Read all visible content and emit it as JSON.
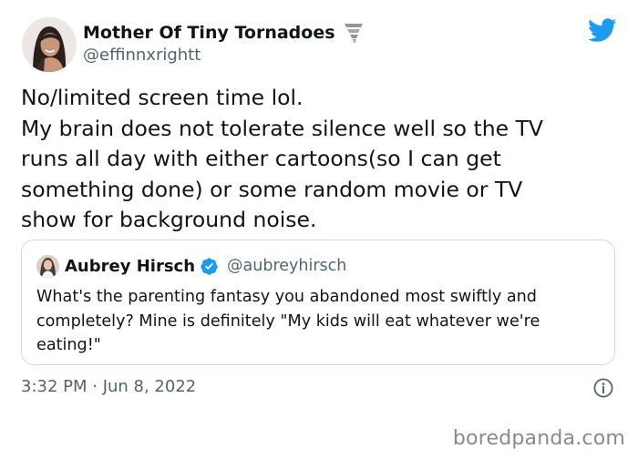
{
  "tweet": {
    "author": {
      "display_name": "Mother Of Tiny Tornadoes",
      "handle": "@effinnxrightt",
      "emoji_icon": "tornado-icon",
      "avatar": "avatar"
    },
    "text_lines": [
      "No/limited screen time lol.",
      "My brain does not tolerate silence well so the TV",
      "runs all day with either cartoons(so I can get",
      "something done) or some random movie or TV",
      "show for background noise."
    ],
    "quote": {
      "display_name": "Aubrey Hirsch",
      "handle": "@aubreyhirsch",
      "verified": true,
      "text_lines": [
        "What's the parenting fantasy you abandoned most swiftly and",
        "completely? Mine is definitely \"My kids will eat whatever we're",
        "eating!\""
      ]
    },
    "timestamp": "3:32 PM · Jun 8, 2022"
  },
  "watermark": "boredpanda.com",
  "colors": {
    "twitter_blue": "#1d9bf0",
    "text_primary": "#0f1419",
    "text_secondary": "#536471",
    "border": "#cfd9de",
    "watermark": "#8a8a8a"
  },
  "icons": {
    "brand": "twitter-bird-icon",
    "verified": "verified-badge-icon",
    "info": "info-icon"
  }
}
